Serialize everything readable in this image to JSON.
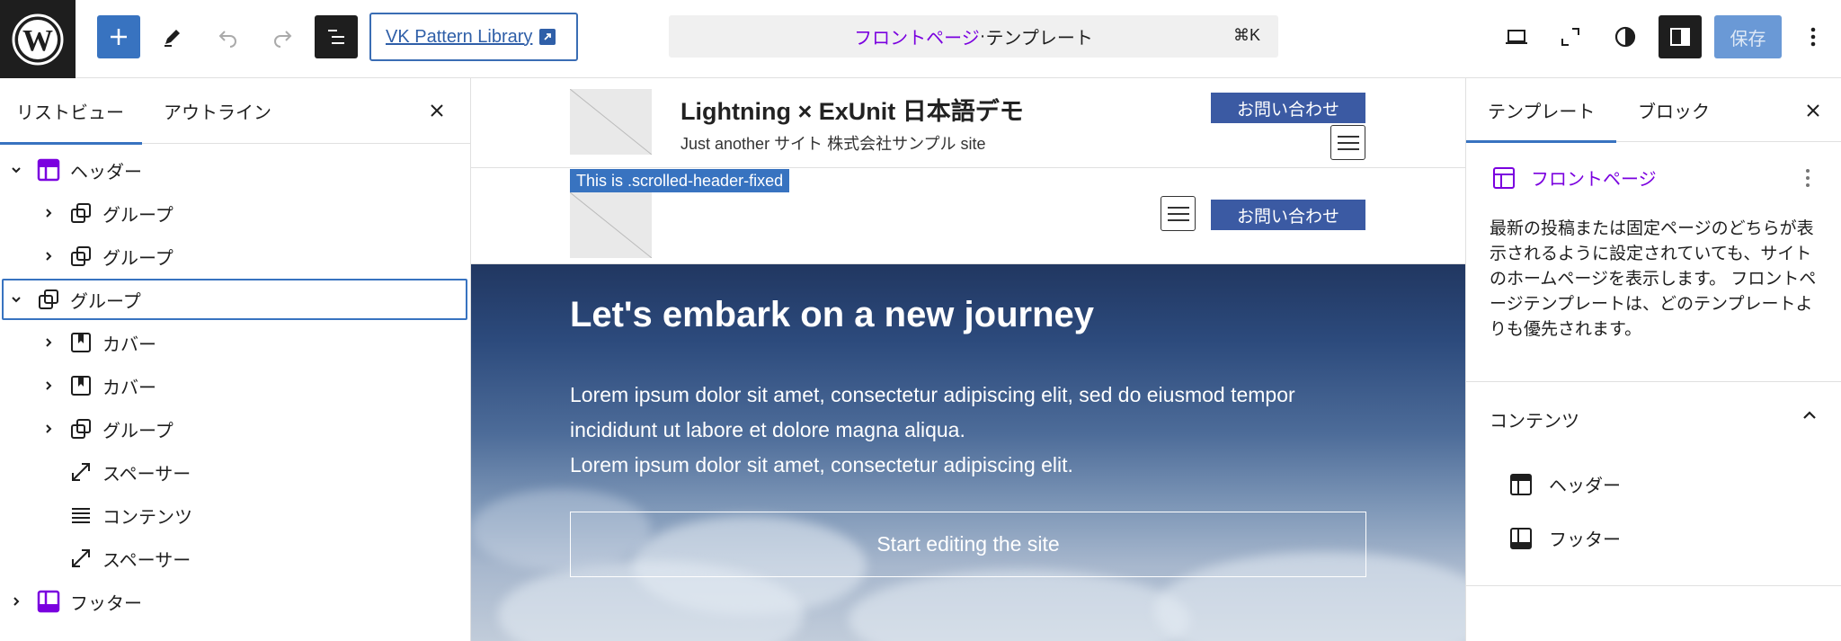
{
  "topbar": {
    "pattern_library_label": "VK Pattern Library",
    "command": {
      "title": "フロントページ",
      "separator": " · ",
      "type": "テンプレート",
      "shortcut": "⌘K"
    },
    "save_label": "保存"
  },
  "left_panel": {
    "tabs": [
      "リストビュー",
      "アウトライン"
    ],
    "tree": [
      {
        "label": "ヘッダー",
        "icon": "template-part-header-icon"
      },
      {
        "label": "グループ",
        "icon": "group-icon"
      },
      {
        "label": "グループ",
        "icon": "group-icon"
      },
      {
        "label": "グループ",
        "icon": "group-icon"
      },
      {
        "label": "カバー",
        "icon": "cover-icon"
      },
      {
        "label": "カバー",
        "icon": "cover-icon"
      },
      {
        "label": "グループ",
        "icon": "group-icon"
      },
      {
        "label": "スペーサー",
        "icon": "spacer-icon"
      },
      {
        "label": "コンテンツ",
        "icon": "post-content-icon"
      },
      {
        "label": "スペーサー",
        "icon": "spacer-icon"
      },
      {
        "label": "フッター",
        "icon": "template-part-footer-icon"
      }
    ]
  },
  "canvas": {
    "site_title": "Lightning × ExUnit 日本語デモ",
    "site_description": "Just another サイト 株式会社サンプル site",
    "contact_button": "お問い合わせ",
    "scrolled_label": "This is .scrolled-header-fixed",
    "hero": {
      "title": "Let's embark on a new journey",
      "paragraph_1": "Lorem ipsum dolor sit amet, consectetur adipiscing elit, sed do eiusmod tempor incididunt ut labore et dolore magna aliqua.",
      "paragraph_2": "Lorem ipsum dolor sit amet, consectetur adipiscing elit.",
      "button": "Start editing the site"
    }
  },
  "right_panel": {
    "tabs": [
      "テンプレート",
      "ブロック"
    ],
    "template_name": "フロントページ",
    "template_description": "最新の投稿または固定ページのどちらが表示されるように設定されていても、サイトのホームページを表示します。 フロントページテンプレートは、どのテンプレートよりも優先されます。",
    "content_heading": "コンテンツ",
    "content_items": [
      "ヘッダー",
      "フッター"
    ]
  },
  "colors": {
    "accent": "#3873c0",
    "template_purple": "#7a00df",
    "contact_button": "#3b5aa3"
  }
}
